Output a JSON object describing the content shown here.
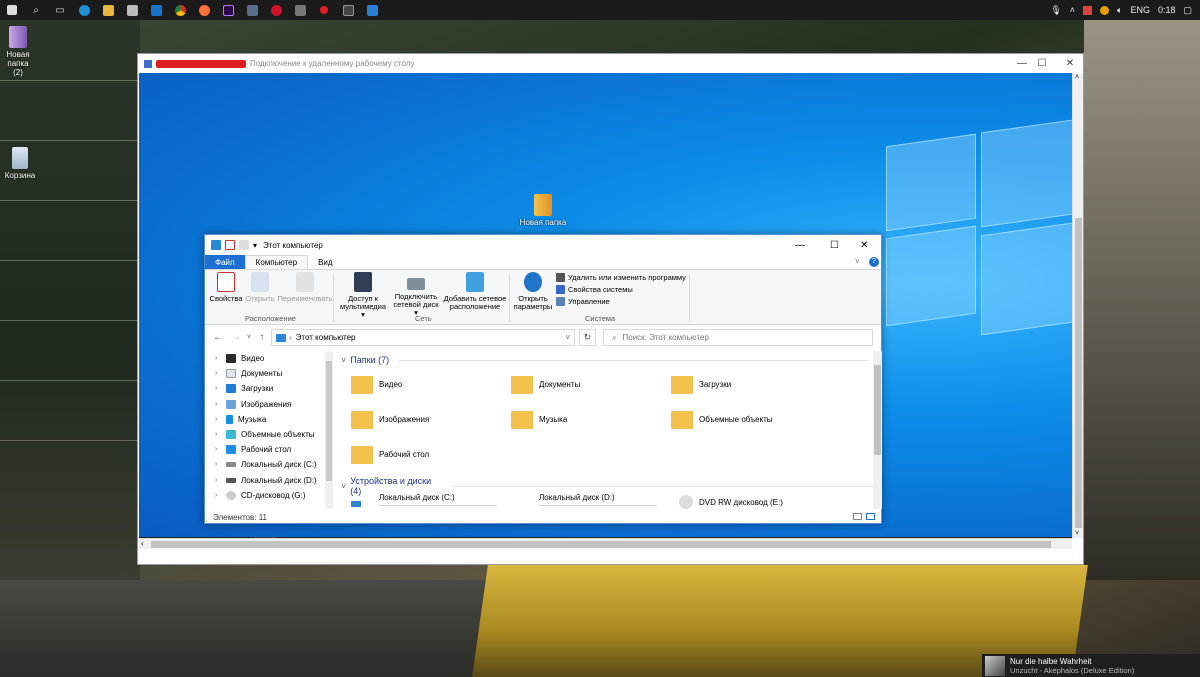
{
  "host": {
    "taskbar_icons": [
      "windows-icon",
      "search-icon",
      "task-view-icon",
      "edge-icon",
      "file-explorer-icon",
      "store-icon",
      "mail-icon",
      "chrome-icon",
      "firefox-icon",
      "premiere-icon",
      "pen-app-icon",
      "opera-icon",
      "calculator-icon",
      "record-icon",
      "media-app-icon",
      "remote-desktop-icon"
    ],
    "tray": {
      "lang": "ENG",
      "time": "0:18"
    },
    "desktop_icons": [
      {
        "label": "Новая папка\n(2)"
      },
      {
        "label": "Корзина"
      }
    ],
    "toast": {
      "title": "Nur die halbe Wahrheit",
      "subtitle": "Unzucht - Akephalos (Deluxe Edition)"
    }
  },
  "rdp": {
    "title": "Подключение к удаленному рабочему столу",
    "desktop_folder": "Новая папка"
  },
  "explorer": {
    "title": "Этот компьютер",
    "tabs": [
      "Файл",
      "Компьютер",
      "Вид"
    ],
    "ribbon": {
      "properties": "Свойства",
      "open": "Открыть",
      "rename": "Переименовать",
      "group_location": "Расположение",
      "media_access_1": "Доступ к",
      "media_access_2": "мультимедиа ▾",
      "map_drive_1": "Подключить",
      "map_drive_2": "сетевой диск ▾",
      "add_net_1": "Добавить сетевое",
      "add_net_2": "расположение",
      "group_network": "Сеть",
      "open_settings_1": "Открыть",
      "open_settings_2": "параметры",
      "uninstall": "Удалить или изменить программу",
      "sys_props": "Свойства системы",
      "manage": "Управление",
      "group_system": "Система"
    },
    "address": "Этот компьютер",
    "search_placeholder": "Поиск: Этот компьютер",
    "nav_items": [
      "Видео",
      "Документы",
      "Загрузки",
      "Изображения",
      "Музыка",
      "Объемные объекты",
      "Рабочий стол",
      "Локальный диск (C:)",
      "Локальный диск (D:)",
      "CD-дисковод (G:)"
    ],
    "folders_header": "Папки (7)",
    "folders": [
      "Видео",
      "Документы",
      "Загрузки",
      "Изображения",
      "Музыка",
      "Объемные объекты",
      "Рабочий стол"
    ],
    "devices_header": "Устройства и диски (4)",
    "devices": [
      "Локальный диск (C:)",
      "Локальный диск (D:)",
      "DVD RW дисковод (E:)"
    ],
    "status": "Элементов: 11"
  }
}
